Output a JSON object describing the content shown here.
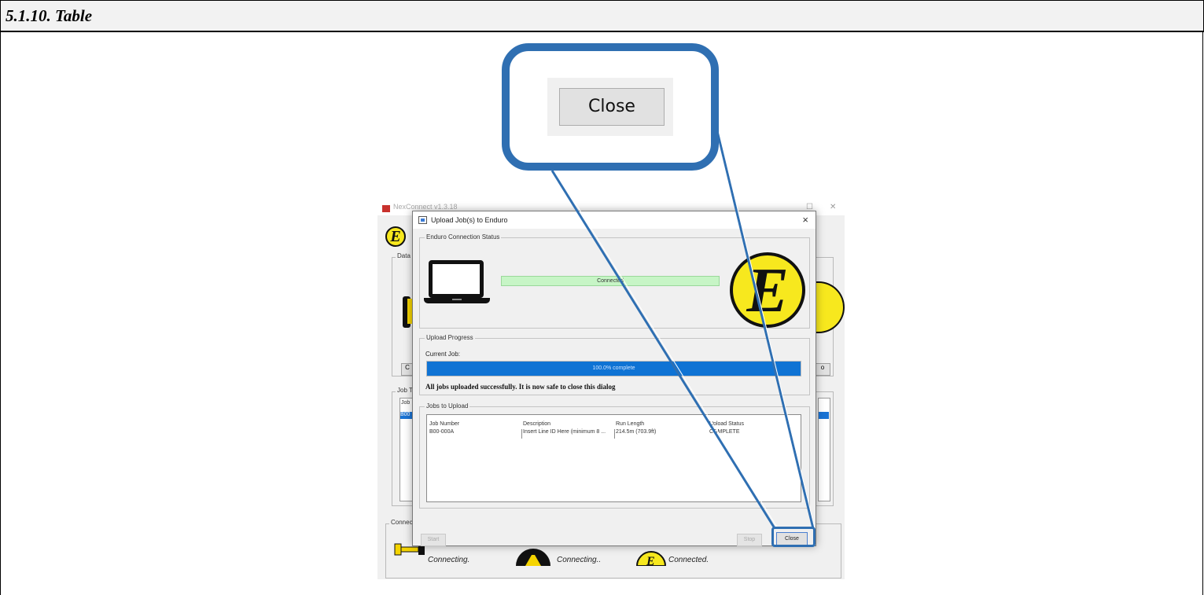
{
  "heading": "5.1.10. Table",
  "background_app": {
    "title": "NexConnect v1.3.18",
    "group_labels": [
      "Data T",
      "Job T",
      "Connect"
    ],
    "column_stub": "Job",
    "row_stub": "B00",
    "button_stub_left": "C",
    "button_stub_right": "o",
    "device_status": [
      {
        "icon": "pump-device-icon",
        "text": "Connecting."
      },
      {
        "icon": "tractor-device-icon",
        "text": "Connecting.."
      },
      {
        "icon": "enduro-e-icon",
        "text": "Connected."
      }
    ]
  },
  "dialog": {
    "title": "Upload Job(s) to Enduro",
    "close_glyph": "×",
    "connection_group": "Enduro Connection Status",
    "connection_status": "Connected",
    "logo_letter": "E",
    "progress_group": "Upload Progress",
    "current_job_label": "Current Job:",
    "progress_percent": 100,
    "progress_text": "100.0% complete",
    "success_message": "All jobs uploaded successfully. It is now safe to close this dialog",
    "jobs_group": "Jobs to Upload",
    "table": {
      "columns": [
        "Job Number",
        "Description",
        "Run Length",
        "Upload Status"
      ],
      "rows": [
        [
          "B00-000A",
          "Insert Line ID Here (minimum 8 ...",
          "214.5m (703.9ft)",
          "COMPLETE"
        ]
      ]
    },
    "buttons": {
      "start": "Start",
      "stop": "Stop",
      "close": "Close"
    }
  },
  "callout": {
    "zoomed_button": "Close"
  },
  "colors": {
    "accent": "#2f6fb2",
    "progress": "#0f73d4",
    "connected": "#c7f5c6",
    "logo_yellow": "#f7e81e"
  }
}
